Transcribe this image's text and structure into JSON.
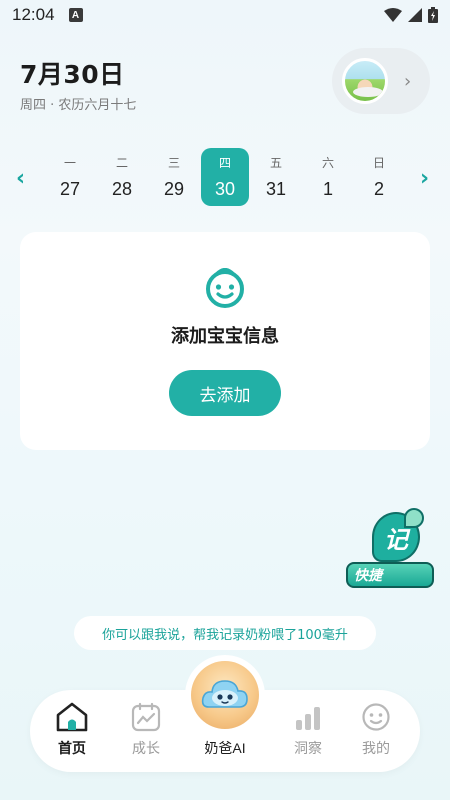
{
  "status_bar": {
    "time": "12:04",
    "notification_icon": "A"
  },
  "header": {
    "date": "7月30日",
    "subtitle": "周四 · 农历六月十七"
  },
  "week": {
    "days": [
      {
        "weekday": "一",
        "date": "27"
      },
      {
        "weekday": "二",
        "date": "28"
      },
      {
        "weekday": "三",
        "date": "29"
      },
      {
        "weekday": "四",
        "date": "30",
        "selected": true
      },
      {
        "weekday": "五",
        "date": "31"
      },
      {
        "weekday": "六",
        "date": "1"
      },
      {
        "weekday": "日",
        "date": "2"
      }
    ]
  },
  "card": {
    "title": "添加宝宝信息",
    "button": "去添加"
  },
  "quick": {
    "icon_text": "记",
    "label": "快捷"
  },
  "hint": "你可以跟我说，帮我记录奶粉喂了100毫升",
  "tabs": [
    {
      "label": "首页",
      "icon": "home-icon",
      "active": true
    },
    {
      "label": "成长",
      "icon": "growth-chart-icon"
    },
    {
      "label": "奶爸AI",
      "icon": "ai-cloud-mascot-icon"
    },
    {
      "label": "洞察",
      "icon": "insight-bars-icon"
    },
    {
      "label": "我的",
      "icon": "smile-face-icon"
    }
  ],
  "colors": {
    "accent": "#22b0a6",
    "hint_text": "#1ba39a"
  }
}
